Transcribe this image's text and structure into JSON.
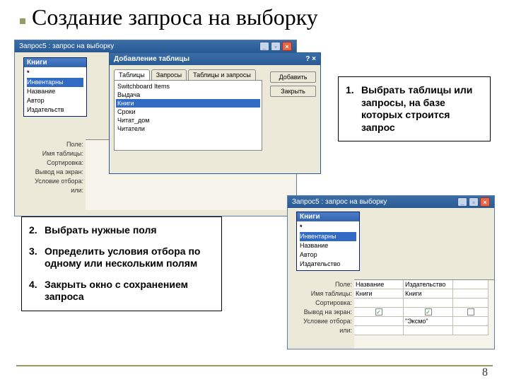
{
  "slide": {
    "title": "Создание запроса на выборку",
    "page": "8"
  },
  "win1": {
    "title": "Запрос5 : запрос на выборку"
  },
  "tableBox1": {
    "title": "Книги",
    "fields": {
      "f0": "*",
      "f1": "Инвентарны",
      "f2": "Название",
      "f3": "Автор",
      "f4": "Издательств"
    }
  },
  "gridLabels": {
    "l1": "Поле:",
    "l2": "Имя таблицы:",
    "l3": "Сортировка:",
    "l4": "Вывод на экран:",
    "l5": "Условие отбора:",
    "l6": "или:"
  },
  "dlg": {
    "title": "Добавление таблицы",
    "tabs": {
      "t1": "Таблицы",
      "t2": "Запросы",
      "t3": "Таблицы и запросы"
    },
    "items": {
      "i0": "Switchboard Items",
      "i1": "Выдача",
      "i2": "Книги",
      "i3": "Сроки",
      "i4": "Читат_дом",
      "i5": "Читатели"
    },
    "buttons": {
      "add": "Добавить",
      "close": "Закрыть"
    }
  },
  "win2": {
    "title": "Запрос5 : запрос на выборку"
  },
  "tableBox2": {
    "title": "Книги",
    "fields": {
      "f0": "*",
      "f1": "Инвентарны",
      "f2": "Название",
      "f3": "Автор",
      "f4": "Издательство"
    }
  },
  "grid2": {
    "col1": {
      "field": "Название",
      "table": "Книги",
      "cond": ""
    },
    "col2": {
      "field": "Издательство",
      "table": "Книги",
      "cond": "\"Эксмо\""
    }
  },
  "callout1": {
    "n": "1.",
    "text": "Выбрать таблицы или запросы, на базе которых строится запрос"
  },
  "callout2": {
    "n2": "2.",
    "t2": "Выбрать нужные поля",
    "n3": "3.",
    "t3": "Определить условия отбора по одному или нескольким полям",
    "n4": "4.",
    "t4": "Закрыть окно с сохранением запроса"
  }
}
